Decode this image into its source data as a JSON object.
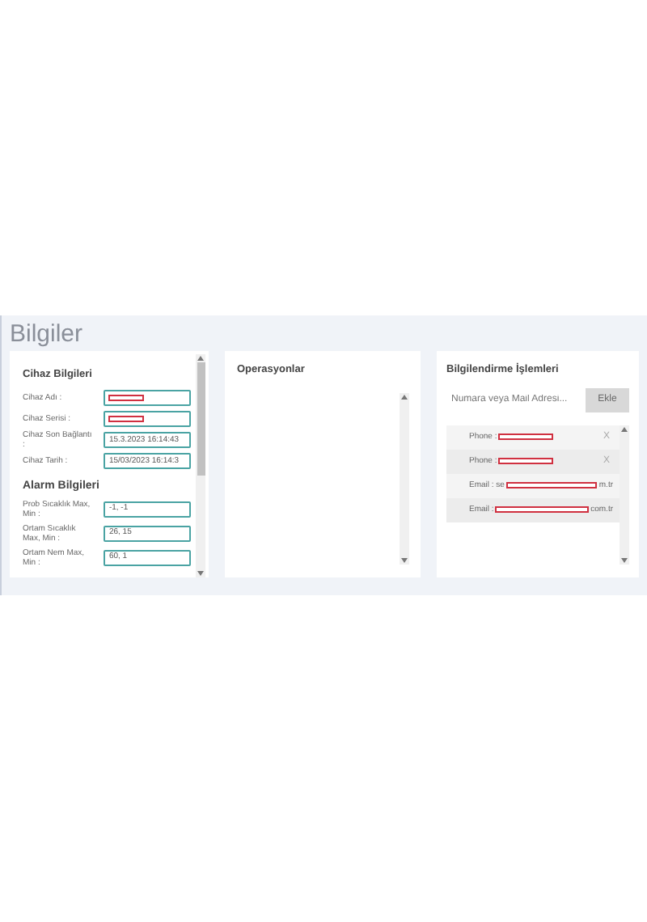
{
  "page_title": "Bilgiler",
  "device": {
    "title": "Cihaz Bilgileri",
    "fields": [
      {
        "label": "Cihaz Adı :",
        "redacted": true
      },
      {
        "label": "Cihaz Serisi :",
        "redacted": true
      },
      {
        "label": "Cihaz Son Bağlantı :",
        "value": "15.3.2023 16:14:43",
        "redacted": false
      },
      {
        "label": "Cihaz Tarih :",
        "value": "15/03/2023 16:14:3",
        "redacted": false
      }
    ]
  },
  "alarm": {
    "title": "Alarm Bilgileri",
    "fields": [
      {
        "label": "Prob Sıcaklık Max, Min :",
        "value": "-1, -1",
        "redacted": false
      },
      {
        "label": "Ortam Sıcaklık Max, Min :",
        "value": "26, 15",
        "redacted": false
      },
      {
        "label": "Ortam Nem Max, Min :",
        "value": "60, 1",
        "redacted": false
      }
    ]
  },
  "operations": {
    "title": "Operasyonlar"
  },
  "notifications": {
    "title": "Bilgilendirme İşlemleri",
    "placeholder": "Numara veya Mail Adresi...",
    "button": "Ekle",
    "items": [
      {
        "prefix": "Phone :",
        "remove": "X"
      },
      {
        "prefix": "Phone :",
        "remove": "X"
      },
      {
        "prefix": "Email : se",
        "suffix": "m.tr"
      },
      {
        "prefix": "Email :",
        "suffix": "com.tr"
      }
    ]
  }
}
